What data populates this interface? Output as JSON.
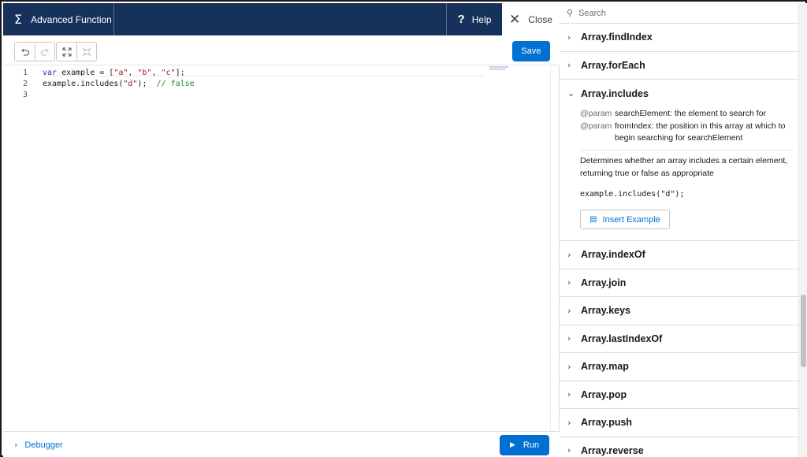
{
  "header": {
    "sigma_glyph": "Σ",
    "title": "Advanced Function",
    "help_glyph": "?",
    "help_label": "Help",
    "close_label": "Close"
  },
  "toolbar": {
    "undo": "undo-icon",
    "redo": "redo-icon",
    "expand": "expand-icon",
    "collapse": "collapse-icon",
    "save_label": "Save"
  },
  "editor": {
    "lines": [
      {
        "num": "1",
        "kw": "var",
        "rest_a": " example = [",
        "s1": "\"a\"",
        "c1": ", ",
        "s2": "\"b\"",
        "c2": ", ",
        "s3": "\"c\"",
        "end": "];"
      },
      {
        "num": "2",
        "pre": "example.includes(",
        "s": "\"d\"",
        "post": ");  ",
        "comment": "// false"
      },
      {
        "num": "3"
      }
    ]
  },
  "bottom": {
    "debugger_label": "Debugger",
    "run_label": "Run"
  },
  "reference": {
    "search_placeholder": "Search",
    "items_before": [
      "Array.findIndex",
      "Array.forEach"
    ],
    "expanded": {
      "name": "Array.includes",
      "params": [
        {
          "tag": "@param",
          "desc": "searchElement: the element to search for"
        },
        {
          "tag": "@param",
          "desc": "fromIndex: the position in this array at which to begin searching for searchElement"
        }
      ],
      "description": "Determines whether an array includes a certain element, returning true or false as appropriate",
      "example": "example.includes(\"d\");",
      "insert_label": "Insert Example"
    },
    "items_after": [
      "Array.indexOf",
      "Array.join",
      "Array.keys",
      "Array.lastIndexOf",
      "Array.map",
      "Array.pop",
      "Array.push",
      "Array.reverse"
    ]
  },
  "colors": {
    "header_bg": "#16325c",
    "brand_blue": "#0070d2"
  }
}
